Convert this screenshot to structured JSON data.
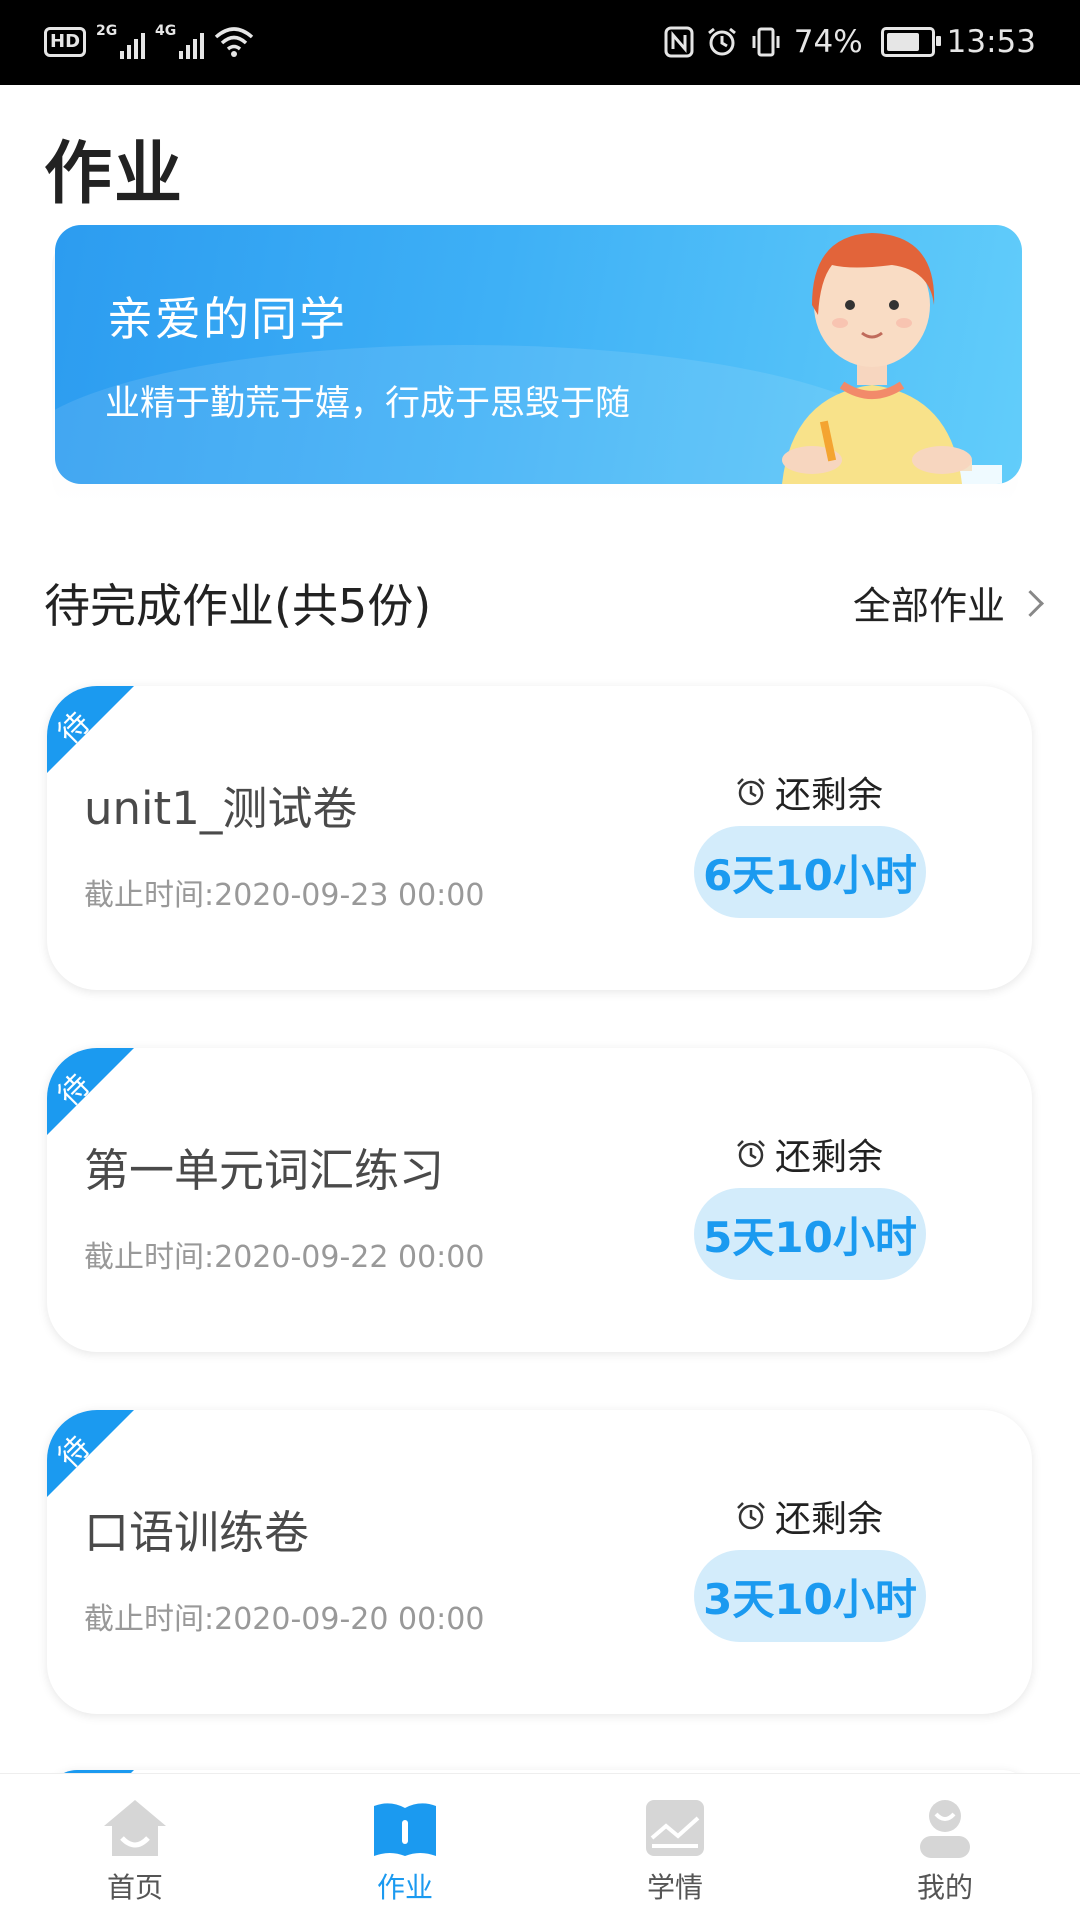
{
  "status_bar": {
    "hd": "HD",
    "net1": "2G",
    "net2": "4G",
    "battery": "74%",
    "time": "13:53"
  },
  "page": {
    "title": "作业"
  },
  "banner": {
    "title": "亲爱的同学",
    "subtitle": "业精于勤荒于嬉，行成于思毁于随"
  },
  "section": {
    "title": "待完成作业(共5份)",
    "all_link": "全部作业"
  },
  "assignments": [
    {
      "tag": "待",
      "name": "unit1_测试卷",
      "deadline": "截止时间:2020-09-23 00:00",
      "remain_label": "还剩余",
      "remain": "6天10小时"
    },
    {
      "tag": "待",
      "name": "第一单元词汇练习",
      "deadline": "截止时间:2020-09-22 00:00",
      "remain_label": "还剩余",
      "remain": "5天10小时"
    },
    {
      "tag": "待",
      "name": "口语训练卷",
      "deadline": "截止时间:2020-09-20 00:00",
      "remain_label": "还剩余",
      "remain": "3天10小时"
    }
  ],
  "nav": {
    "items": [
      {
        "label": "首页",
        "icon": "home-icon"
      },
      {
        "label": "作业",
        "icon": "book-icon",
        "active": true
      },
      {
        "label": "学情",
        "icon": "chart-icon"
      },
      {
        "label": "我的",
        "icon": "user-icon"
      }
    ]
  },
  "colors": {
    "accent": "#1b9af0",
    "pill_bg": "#d3ecfb",
    "ribbon": "#1b9af0",
    "inactive_icon": "#d6d6d6"
  }
}
